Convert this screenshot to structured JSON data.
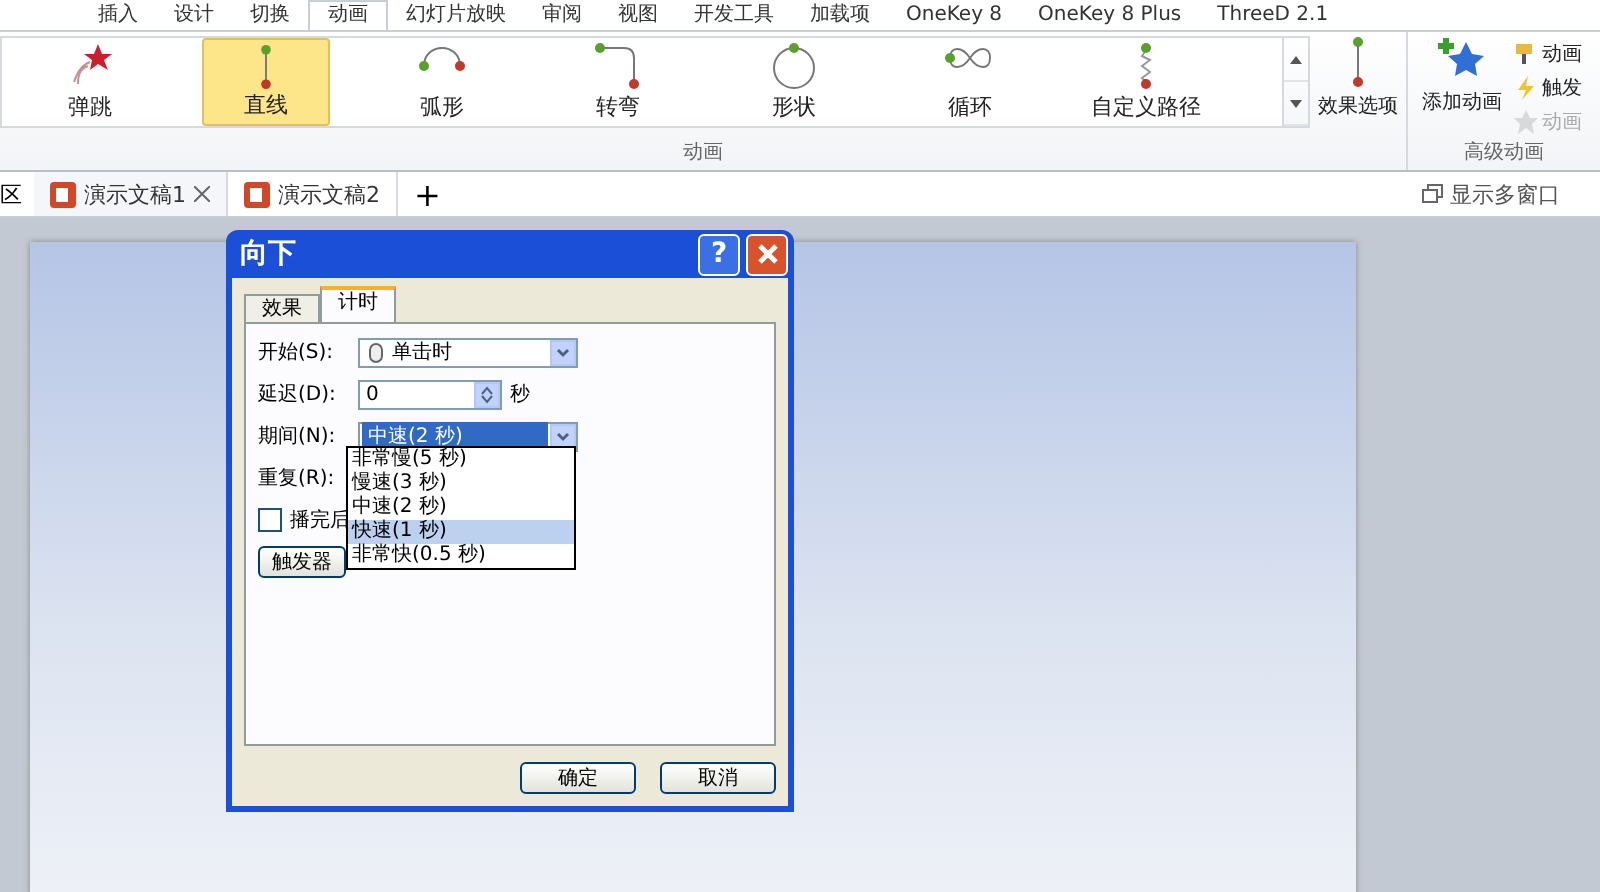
{
  "menu_tabs": [
    {
      "label": "插入",
      "selected": false
    },
    {
      "label": "设计",
      "selected": false
    },
    {
      "label": "切换",
      "selected": false
    },
    {
      "label": "动画",
      "selected": true
    },
    {
      "label": "幻灯片放映",
      "selected": false
    },
    {
      "label": "审阅",
      "selected": false
    },
    {
      "label": "视图",
      "selected": false
    },
    {
      "label": "开发工具",
      "selected": false
    },
    {
      "label": "加载项",
      "selected": false
    },
    {
      "label": "OneKey 8",
      "selected": false
    },
    {
      "label": "OneKey 8 Plus",
      "selected": false
    },
    {
      "label": "ThreeD 2.1",
      "selected": false
    }
  ],
  "gallery": [
    {
      "label": "弹跳",
      "kind": "bounce",
      "selected": false
    },
    {
      "label": "直线",
      "kind": "line",
      "selected": true
    },
    {
      "label": "弧形",
      "kind": "arc",
      "selected": false
    },
    {
      "label": "转弯",
      "kind": "turn",
      "selected": false
    },
    {
      "label": "形状",
      "kind": "shape",
      "selected": false
    },
    {
      "label": "循环",
      "kind": "loop",
      "selected": false
    },
    {
      "label": "自定义路径",
      "kind": "custom",
      "selected": false
    }
  ],
  "effect_options": "效果选项",
  "animation_group": "动画",
  "advanced": {
    "add": "添加动画",
    "items": [
      {
        "label": "动画",
        "kind": "painter",
        "disabled": false
      },
      {
        "label": "触发",
        "kind": "trigger",
        "disabled": false
      },
      {
        "label": "动画",
        "kind": "pane",
        "disabled": true
      }
    ],
    "group": "高级动画"
  },
  "doc_tabs": {
    "left_cut": "区",
    "tabs": [
      {
        "label": "演示文稿1",
        "selected": true
      },
      {
        "label": "演示文稿2",
        "selected": false
      }
    ],
    "new": "+",
    "multi_window": "显示多窗口"
  },
  "dialog": {
    "title": "向下",
    "help": "?",
    "tabs": [
      {
        "label": "效果",
        "selected": false
      },
      {
        "label": "计时",
        "selected": true
      }
    ],
    "start_label": "开始(S):",
    "start_value": "单击时",
    "delay_label": "延迟(D):",
    "delay_value": "0",
    "delay_unit": "秒",
    "duration_label": "期间(N):",
    "duration_value": "中速(2 秒)",
    "duration_options": [
      {
        "label": "非常慢(5 秒)",
        "selected": false
      },
      {
        "label": "慢速(3 秒)",
        "selected": false
      },
      {
        "label": "中速(2 秒)",
        "selected": false
      },
      {
        "label": "快速(1 秒)",
        "selected": true
      },
      {
        "label": "非常快(0.5 秒)",
        "selected": false
      }
    ],
    "repeat_label": "重复(R):",
    "rewind": {
      "label": "播完后",
      "checked": false
    },
    "trigger_button": "触发器",
    "ok": "确定",
    "cancel": "取消"
  }
}
